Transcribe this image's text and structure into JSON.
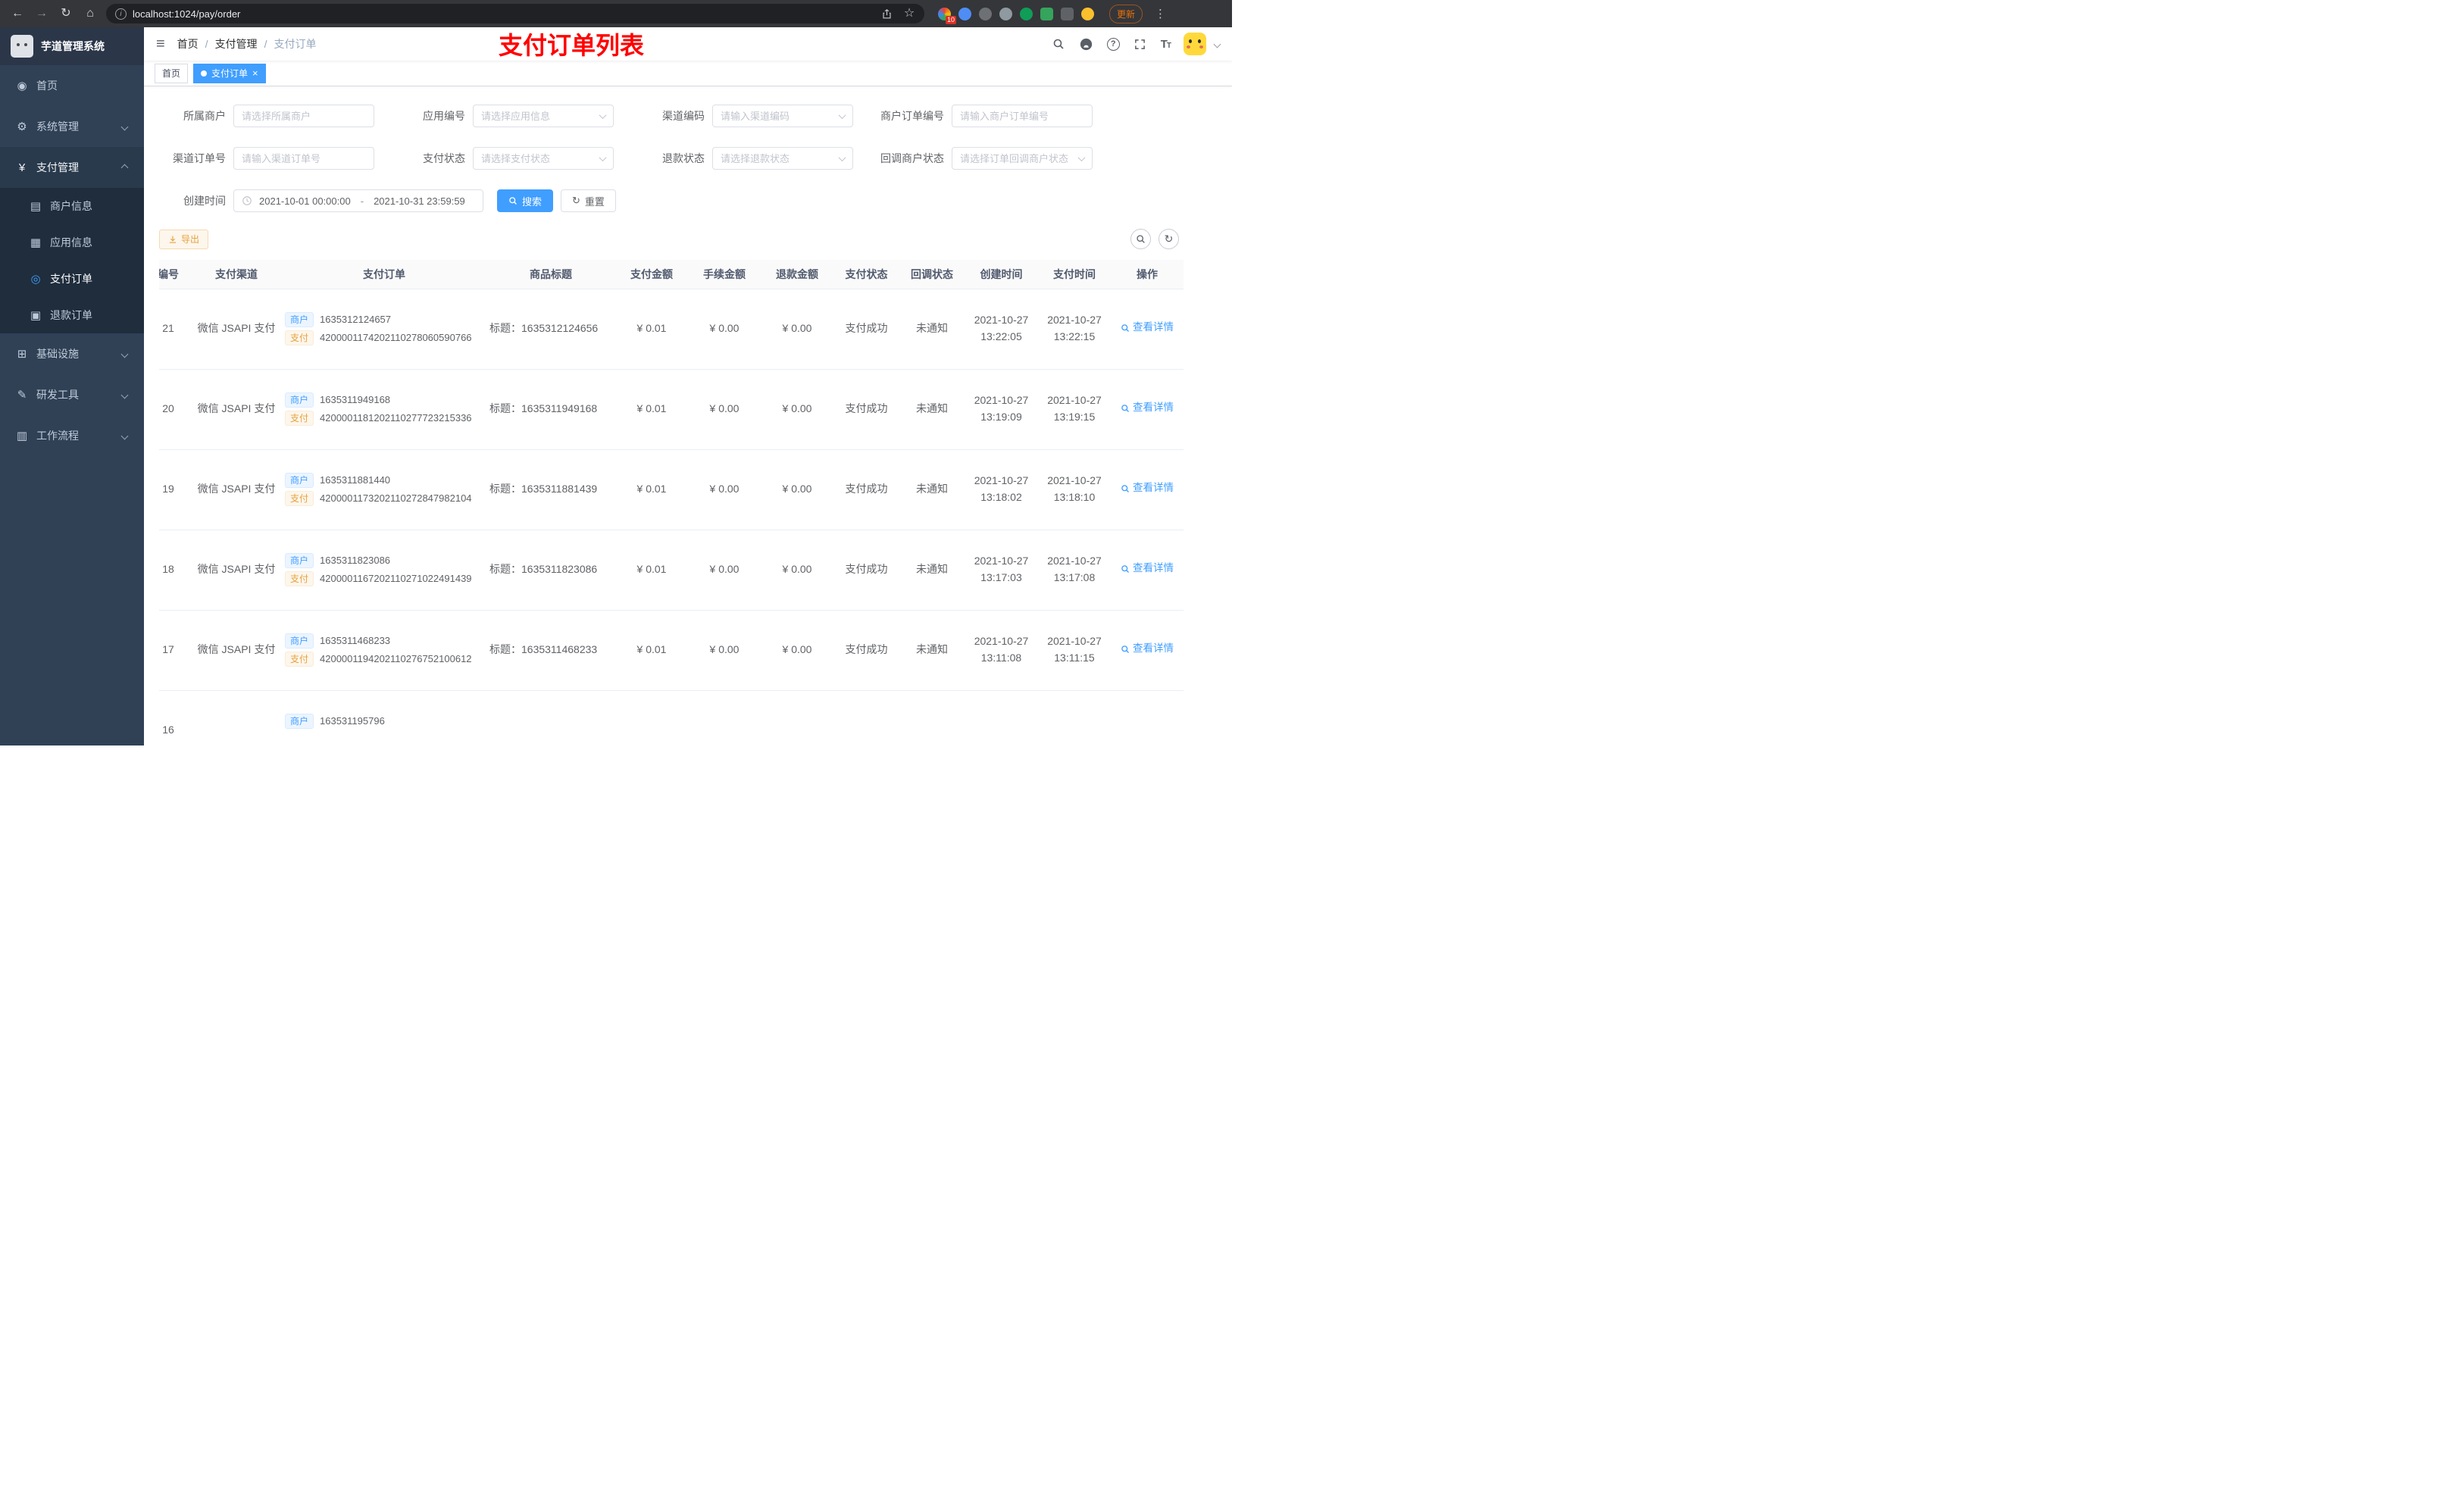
{
  "browser": {
    "url": "localhost:1024/pay/order",
    "update_label": "更新",
    "extension_badge": "10"
  },
  "sidebar": {
    "logo_title": "芋道管理系统",
    "items": [
      {
        "label": "首页"
      },
      {
        "label": "系统管理"
      },
      {
        "label": "支付管理"
      },
      {
        "label": "基础设施"
      },
      {
        "label": "研发工具"
      },
      {
        "label": "工作流程"
      }
    ],
    "submenu": [
      {
        "label": "商户信息"
      },
      {
        "label": "应用信息"
      },
      {
        "label": "支付订单"
      },
      {
        "label": "退款订单"
      }
    ]
  },
  "header": {
    "breadcrumb": [
      "首页",
      "支付管理",
      "支付订单"
    ],
    "separator": "/",
    "annotation": "支付订单列表"
  },
  "tabs": [
    {
      "label": "首页"
    },
    {
      "label": "支付订单"
    }
  ],
  "filters": {
    "fields": [
      {
        "label": "所属商户",
        "placeholder": "请选择所属商户",
        "type": "input"
      },
      {
        "label": "应用编号",
        "placeholder": "请选择应用信息",
        "type": "select"
      },
      {
        "label": "渠道编码",
        "placeholder": "请输入渠道编码",
        "type": "select"
      },
      {
        "label": "商户订单编号",
        "placeholder": "请输入商户订单编号",
        "type": "input"
      },
      {
        "label": "渠道订单号",
        "placeholder": "请输入渠道订单号",
        "type": "input"
      },
      {
        "label": "支付状态",
        "placeholder": "请选择支付状态",
        "type": "select"
      },
      {
        "label": "退款状态",
        "placeholder": "请选择退款状态",
        "type": "select"
      },
      {
        "label": "回调商户状态",
        "placeholder": "请选择订单回调商户状态",
        "type": "select"
      }
    ],
    "date_label": "创建时间",
    "date_start": "2021-10-01 00:00:00",
    "date_separator": "-",
    "date_end": "2021-10-31 23:59:59",
    "search_label": "搜索",
    "reset_label": "重置"
  },
  "toolbar": {
    "export_label": "导出"
  },
  "table": {
    "columns": [
      "编号",
      "支付渠道",
      "支付订单",
      "商品标题",
      "支付金额",
      "手续金额",
      "退款金额",
      "支付状态",
      "回调状态",
      "创建时间",
      "支付时间",
      "操作"
    ],
    "rows": [
      {
        "id": "21",
        "channel": "微信 JSAPI 支付",
        "merchant_tag": "商户",
        "merchant_no": "1635312124657",
        "pay_tag": "支付",
        "pay_no": "4200001174202110278060590766",
        "title": "标题：1635312124656",
        "pay_amount": "¥ 0.01",
        "fee_amount": "¥ 0.00",
        "refund_amount": "¥ 0.00",
        "pay_status": "支付成功",
        "notify_status": "未通知",
        "create_time": "2021-10-27 13:22:05",
        "pay_time": "2021-10-27 13:22:15",
        "action": "查看详情"
      },
      {
        "id": "20",
        "channel": "微信 JSAPI 支付",
        "merchant_tag": "商户",
        "merchant_no": "1635311949168",
        "pay_tag": "支付",
        "pay_no": "4200001181202110277723215336",
        "title": "标题：1635311949168",
        "pay_amount": "¥ 0.01",
        "fee_amount": "¥ 0.00",
        "refund_amount": "¥ 0.00",
        "pay_status": "支付成功",
        "notify_status": "未通知",
        "create_time": "2021-10-27 13:19:09",
        "pay_time": "2021-10-27 13:19:15",
        "action": "查看详情"
      },
      {
        "id": "19",
        "channel": "微信 JSAPI 支付",
        "merchant_tag": "商户",
        "merchant_no": "1635311881440",
        "pay_tag": "支付",
        "pay_no": "4200001173202110272847982104",
        "title": "标题：1635311881439",
        "pay_amount": "¥ 0.01",
        "fee_amount": "¥ 0.00",
        "refund_amount": "¥ 0.00",
        "pay_status": "支付成功",
        "notify_status": "未通知",
        "create_time": "2021-10-27 13:18:02",
        "pay_time": "2021-10-27 13:18:10",
        "action": "查看详情"
      },
      {
        "id": "18",
        "channel": "微信 JSAPI 支付",
        "merchant_tag": "商户",
        "merchant_no": "1635311823086",
        "pay_tag": "支付",
        "pay_no": "4200001167202110271022491439",
        "title": "标题：1635311823086",
        "pay_amount": "¥ 0.01",
        "fee_amount": "¥ 0.00",
        "refund_amount": "¥ 0.00",
        "pay_status": "支付成功",
        "notify_status": "未通知",
        "create_time": "2021-10-27 13:17:03",
        "pay_time": "2021-10-27 13:17:08",
        "action": "查看详情"
      },
      {
        "id": "17",
        "channel": "微信 JSAPI 支付",
        "merchant_tag": "商户",
        "merchant_no": "1635311468233",
        "pay_tag": "支付",
        "pay_no": "4200001194202110276752100612",
        "title": "标题：1635311468233",
        "pay_amount": "¥ 0.01",
        "fee_amount": "¥ 0.00",
        "refund_amount": "¥ 0.00",
        "pay_status": "支付成功",
        "notify_status": "未通知",
        "create_time": "2021-10-27 13:11:08",
        "pay_time": "2021-10-27 13:11:15",
        "action": "查看详情"
      },
      {
        "id": "16",
        "merchant_tag": "商户",
        "merchant_no": "163531195796"
      }
    ]
  }
}
